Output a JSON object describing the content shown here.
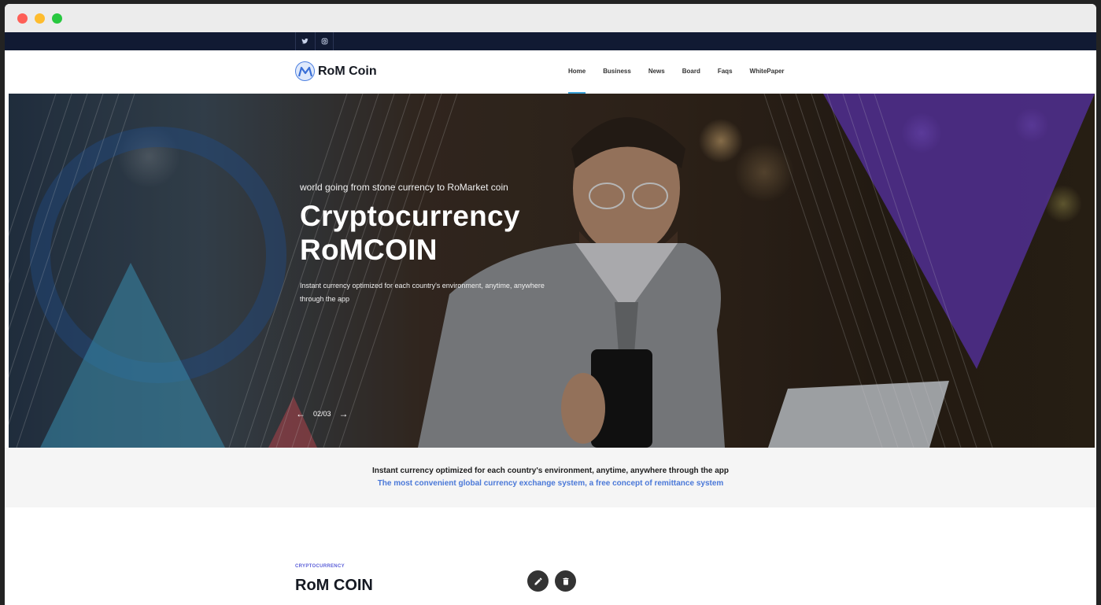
{
  "window": {
    "controls": [
      "close",
      "minimize",
      "maximize"
    ]
  },
  "topbar": {
    "social_icons": [
      "twitter-icon",
      "instagram-icon"
    ]
  },
  "navbar": {
    "logo_text": "RoM Coin",
    "menu": [
      {
        "label": "Home",
        "active": true
      },
      {
        "label": "Business",
        "active": false
      },
      {
        "label": "News",
        "active": false
      },
      {
        "label": "Board",
        "active": false
      },
      {
        "label": "Faqs",
        "active": false
      },
      {
        "label": "WhitePaper",
        "active": false
      }
    ]
  },
  "hero": {
    "subtitle": "world going from stone currency to RoMarket coin",
    "title_line1": "Cryptocurrency",
    "title_line2": "RoMCOIN",
    "description": "Instant currency optimized for each country's environment, anytime, anywhere through the app",
    "slide_counter": "02/03",
    "prev_arrow": "←",
    "next_arrow": "→"
  },
  "banner": {
    "line1": "Instant currency optimized for each country's environment, anytime, anywhere through the app",
    "line2": "The most convenient global currency exchange system, a free concept of remittance system"
  },
  "section": {
    "tag": "CRYPTOCURRENCY",
    "title": "RoM COIN"
  },
  "colors": {
    "topbar_bg": "#111a33",
    "accent": "#3aa0d6",
    "link_blue": "#4a78d8",
    "tag_purple": "#5b5fd8"
  }
}
